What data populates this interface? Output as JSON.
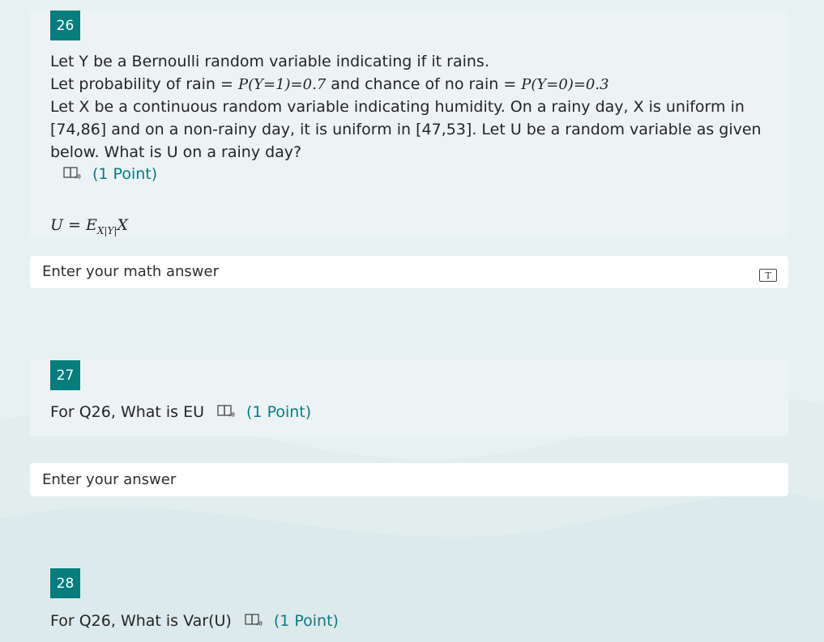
{
  "q26": {
    "number": "26",
    "line1": "Let Y be a Bernoulli random variable indicating if it rains.",
    "line2_prefix": "Let probability of rain = ",
    "line2_math1": "P(Y=1)=0.7",
    "line2_mid": " and chance of no rain = ",
    "line2_math2": "P(Y=0)=0.3",
    "line3": "Let X be a continuous random variable indicating humidity. On a rainy day, X is uniform in",
    "line4": "[74,86] and on a non-rainy day, it is uniform in [47,53]. Let U be a random variable as given",
    "line5": "below. What is U on a rainy day?",
    "points": "(1 Point)",
    "formula_lhs": "U",
    "formula_eq": " = ",
    "formula_E": "E",
    "formula_sub": "X|Y|",
    "formula_X": "X",
    "answer_placeholder": "Enter your math answer",
    "toggle_label": "T"
  },
  "q27": {
    "number": "27",
    "text": "For Q26, What is EU",
    "points": "(1 Point)",
    "answer_placeholder": "Enter your answer"
  },
  "q28": {
    "number": "28",
    "text": "For Q26, What is Var(U)",
    "points": "(1 Point)"
  },
  "colors": {
    "accent": "#077d7d",
    "points": "#0d7a83",
    "background": "#e6f1f2"
  }
}
